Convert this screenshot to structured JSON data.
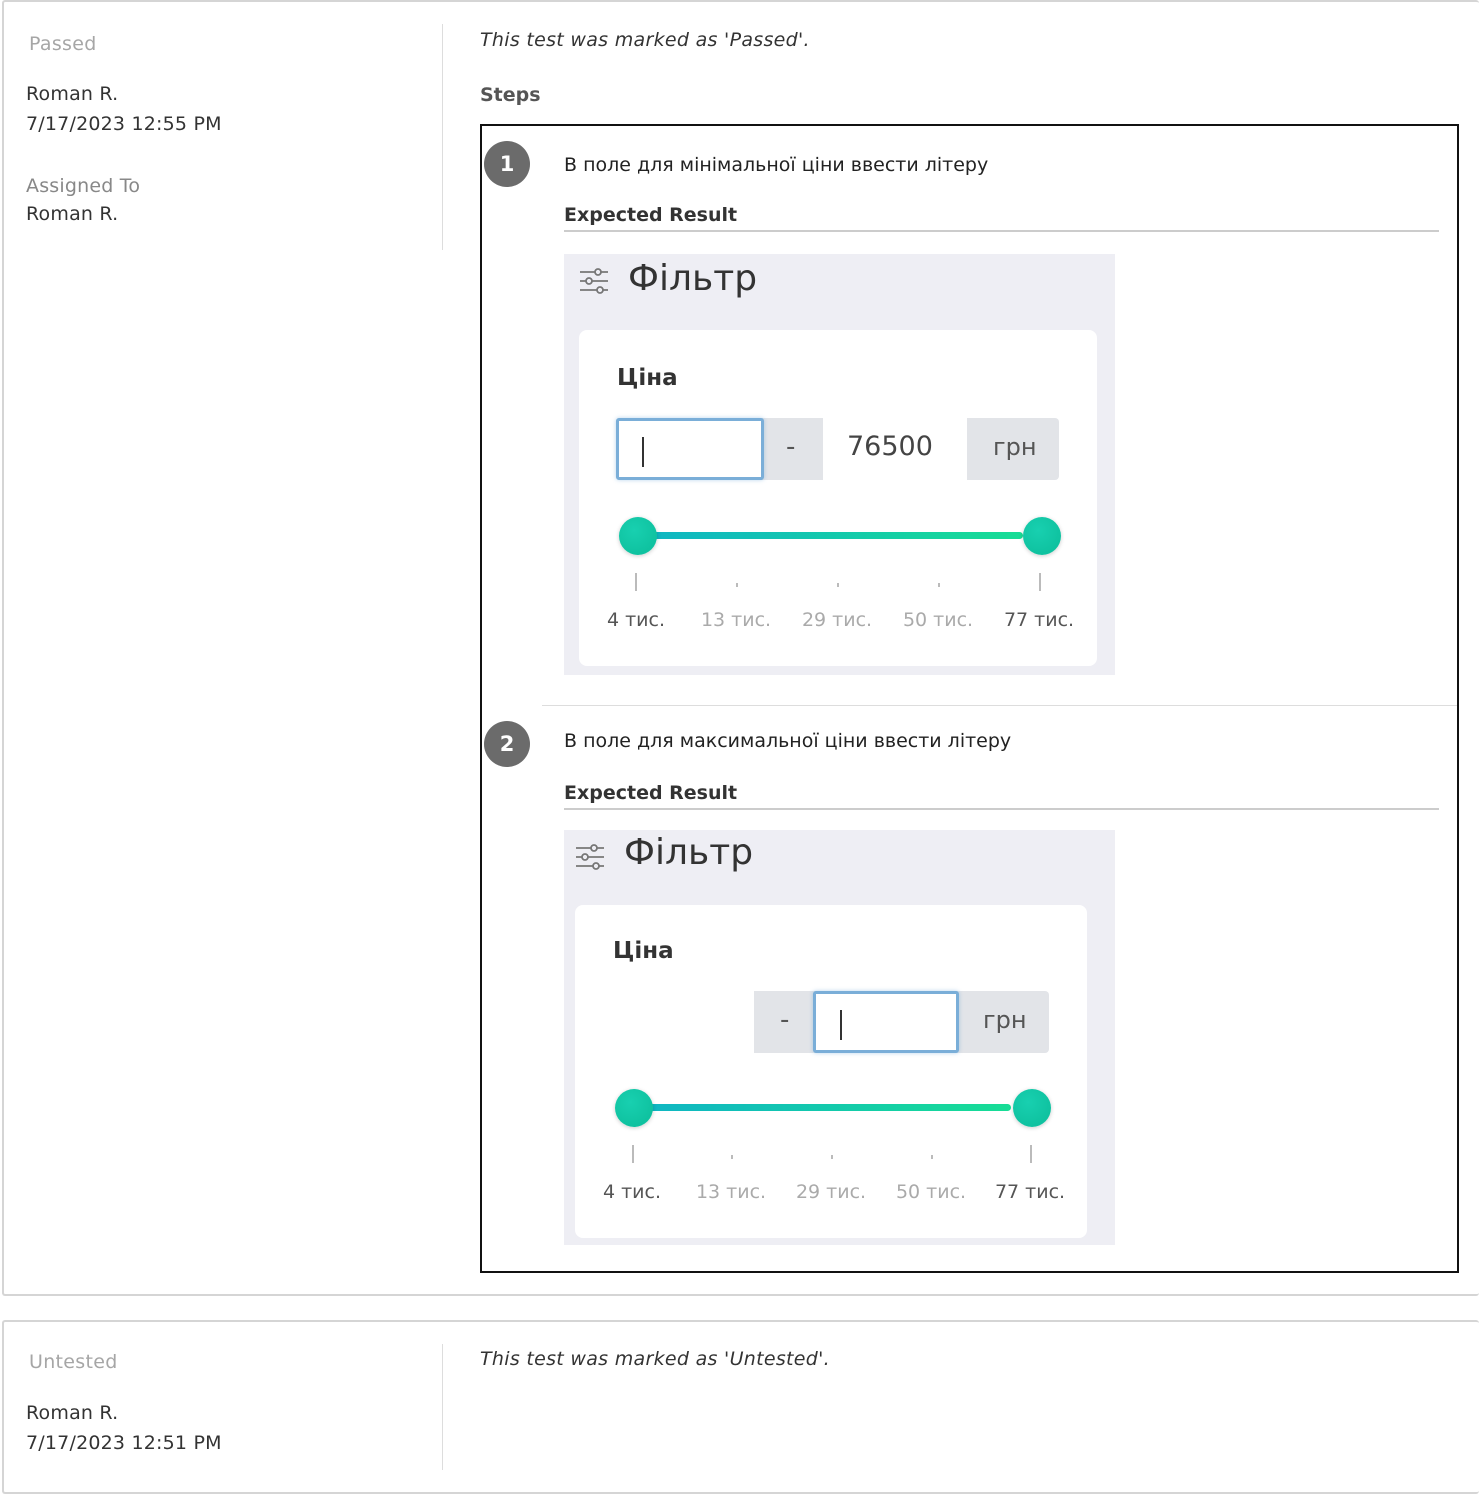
{
  "results": [
    {
      "status": "Passed",
      "user": "Roman R.",
      "datetime": "7/17/2023 12:55 PM",
      "assigned_label": "Assigned To",
      "assigned_value": "Roman R.",
      "note": "This test was marked as 'Passed'.",
      "steps_label": "Steps",
      "steps": [
        {
          "number": "1",
          "text": "В поле для мінімальної ціни ввести літеру",
          "expected_label": "Expected Result",
          "screenshot": {
            "title": "Фільтр",
            "price_label": "Ціна",
            "min_value": "",
            "max_value": "76500",
            "dash": "-",
            "unit": "грн",
            "focused_field": "min",
            "ticks": [
              "4 тис.",
              "13 тис.",
              "29 тис.",
              "50 тис.",
              "77 тис."
            ]
          }
        },
        {
          "number": "2",
          "text": "В поле для максимальної ціни ввести літеру",
          "expected_label": "Expected Result",
          "screenshot": {
            "title": "Фільтр",
            "price_label": "Ціна",
            "min_value": "",
            "max_value": "",
            "dash": "-",
            "unit": "грн",
            "focused_field": "max",
            "ticks": [
              "4 тис.",
              "13 тис.",
              "29 тис.",
              "50 тис.",
              "77 тис."
            ]
          }
        }
      ]
    },
    {
      "status": "Untested",
      "user": "Roman R.",
      "datetime": "7/17/2023 12:51 PM",
      "note": "This test was marked as 'Untested'."
    }
  ],
  "colors": {
    "step_badge": "#6b6b6b",
    "slider_start": "#0fb5c4",
    "slider_end": "#17dd95",
    "focus_border": "#7aaed8"
  },
  "icons": {
    "filter": "sliders-icon"
  }
}
